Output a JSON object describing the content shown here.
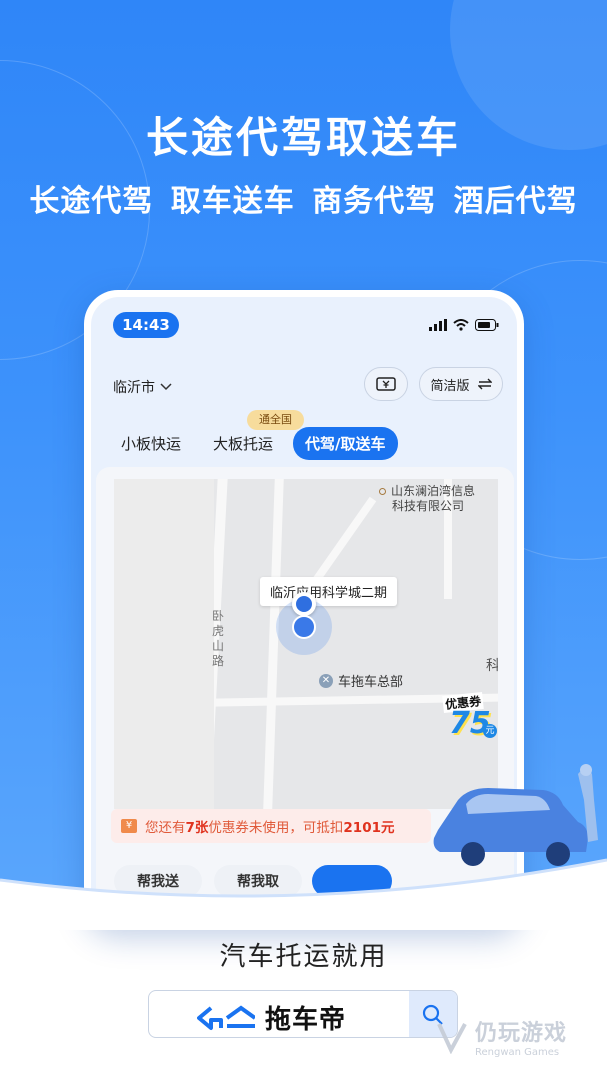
{
  "hero": {
    "headline": "长途代驾取送车",
    "subline": "长途代驾 取车送车 商务代驾 酒后代驾"
  },
  "phone": {
    "status_time": "14:43",
    "city": "临沂市",
    "mode_button": "简洁版",
    "tabs": [
      {
        "label": "小板快运",
        "active": false
      },
      {
        "label": "大板托运",
        "active": false
      },
      {
        "label": "代驾/取送车",
        "active": true
      }
    ],
    "tab_badge": "通全国",
    "map": {
      "poi_company_line1": "山东澜泊湾信息",
      "poi_company_line2": "科技有限公司",
      "road_name": "卧虎山路",
      "selected_place": "临沂应用科学城二期",
      "nearby_poi": "车拖车总部",
      "edge_char": "科",
      "coupon_sticker_top": "优惠券",
      "coupon_sticker_amount": "75",
      "coupon_sticker_unit": "元"
    },
    "coupon_notice": {
      "prefix": "您还有",
      "count": "7张",
      "middle": "优惠券未使用，可抵扣",
      "amount": "2101元"
    },
    "service_chips": [
      "帮我送",
      "帮我取"
    ]
  },
  "footer": {
    "slogan": "汽车托运就用",
    "brand": "拖车帝",
    "watermark_title": "仍玩游戏",
    "watermark_sub": "Rengwan Games"
  },
  "colors": {
    "primary_blue": "#1a73f0",
    "hero_blue": "#2f86f8",
    "coupon_red": "#e0321e",
    "badge_gold": "#f7dc9c"
  }
}
